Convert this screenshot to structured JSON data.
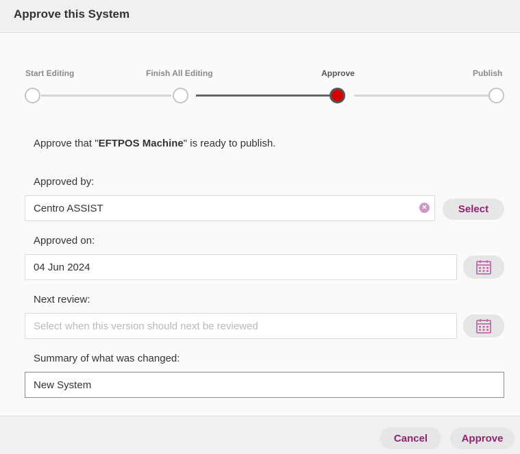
{
  "dialog": {
    "title": "Approve this System"
  },
  "steps": [
    {
      "label": "Start Editing"
    },
    {
      "label": "Finish All Editing"
    },
    {
      "label": "Approve"
    },
    {
      "label": "Publish"
    }
  ],
  "intro": {
    "before": "Approve that \"",
    "name": "EFTPOS Machine",
    "after": "\" is ready to publish."
  },
  "approved_by": {
    "label": "Approved by:",
    "value": "Centro ASSIST",
    "select_label": "Select"
  },
  "approved_on": {
    "label": "Approved on:",
    "value": "04 Jun 2024",
    "icon": "calendar-icon"
  },
  "next_review": {
    "label": "Next review:",
    "placeholder": "Select when this version should next be reviewed",
    "icon": "calendar-icon"
  },
  "summary": {
    "label": "Summary of what was changed:",
    "value": "New System"
  },
  "footer": {
    "cancel_label": "Cancel",
    "approve_label": "Approve"
  },
  "colors": {
    "accent": "#8e2471",
    "active_step": "#d50000",
    "calendar_icon": "#c06aa8"
  }
}
